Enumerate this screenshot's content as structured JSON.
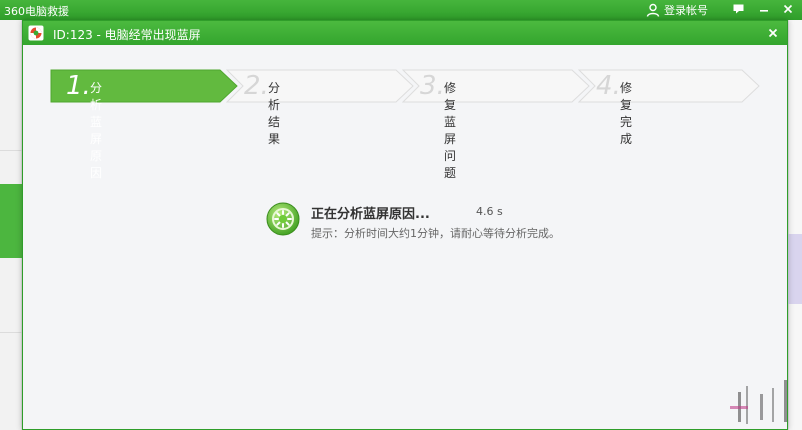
{
  "app": {
    "title": "360电脑救援",
    "login_label": "登录帐号"
  },
  "dialog": {
    "title": "ID:123 - 电脑经常出现蓝屏"
  },
  "steps": [
    {
      "num": "1.",
      "label": "分析蓝屏原因",
      "active": true
    },
    {
      "num": "2.",
      "label": "分析结果",
      "active": false
    },
    {
      "num": "3.",
      "label": "修复蓝屏问题",
      "active": false
    },
    {
      "num": "4.",
      "label": "修复完成",
      "active": false
    }
  ],
  "progress": {
    "status": "正在分析蓝屏原因...",
    "elapsed": "4.6 s",
    "hint": "提示：分析时间大约1分钟，请耐心等待分析完成。"
  },
  "colors": {
    "brand_green": "#3aab33",
    "active_step": "#62ba3f",
    "inactive_step": "#f7f7f7"
  },
  "icons": {
    "logo": "lifebuoy-icon",
    "user": "user-icon",
    "message": "message-icon",
    "minimize": "minimize-icon",
    "close": "close-icon",
    "progress": "spinner-icon"
  }
}
